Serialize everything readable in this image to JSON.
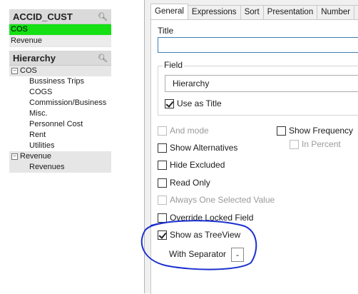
{
  "listbox_customer": {
    "title": "ACCID_CUST",
    "search_icon": "search-icon",
    "items": [
      {
        "label": "COS",
        "state": "selected"
      },
      {
        "label": "Revenue",
        "state": "alternative"
      }
    ]
  },
  "listbox_hierarchy": {
    "title": "Hierarchy",
    "search_icon": "search-icon",
    "groups": [
      {
        "label": "COS",
        "toggle": "⊟",
        "children": [
          "Bussiness Trips",
          "COGS",
          "Commission/Business",
          "Misc.",
          "Personnel Cost",
          "Rent",
          "Utilities"
        ]
      },
      {
        "label": "Revenue",
        "toggle": "⊟",
        "children": [
          "Revenues"
        ]
      }
    ]
  },
  "dialog": {
    "tabs": [
      "General",
      "Expressions",
      "Sort",
      "Presentation",
      "Number",
      "F"
    ],
    "active_tab": "General",
    "title_label": "Title",
    "title_value": "",
    "field_group_label": "Field",
    "field_value": "Hierarchy",
    "use_as_title": {
      "label": "Use as Title",
      "checked": true
    },
    "options": {
      "and_mode": {
        "label": "And mode",
        "checked": false,
        "disabled": true
      },
      "show_alternatives": {
        "label": "Show Alternatives",
        "checked": false,
        "disabled": false
      },
      "hide_excluded": {
        "label": "Hide Excluded",
        "checked": false,
        "disabled": false
      },
      "read_only": {
        "label": "Read Only",
        "checked": false,
        "disabled": false
      },
      "always_one_selected": {
        "label": "Always One Selected Value",
        "checked": false,
        "disabled": true
      },
      "override_locked": {
        "label": "Override Locked Field",
        "checked": false,
        "disabled": false
      },
      "show_as_treeview": {
        "label": "Show as TreeView",
        "checked": true,
        "disabled": false
      },
      "show_frequency": {
        "label": "Show Frequency",
        "checked": false,
        "disabled": false
      },
      "in_percent": {
        "label": "In Percent",
        "checked": false,
        "disabled": true
      }
    },
    "separator_label": "With Separator",
    "separator_value": "-"
  },
  "colors": {
    "selected": "#14e014",
    "annotation": "#1a2fd0"
  }
}
